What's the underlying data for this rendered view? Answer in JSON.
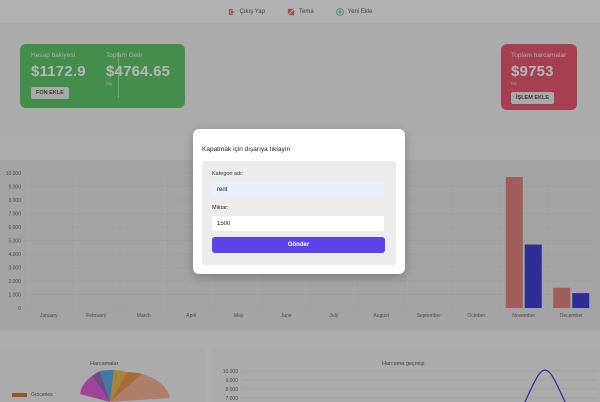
{
  "nav": {
    "logout_label": "Çıkış Yap",
    "theme_label": "Tema",
    "add_label": "Yeni Ekle"
  },
  "balance_card": {
    "balance_label": "Hesap bakiyesi",
    "balance_value": "$1172.9",
    "income_label": "Toplam Gelir",
    "income_value": "$4764.65",
    "income_sub": "/ay",
    "button_label": "FON EKLE"
  },
  "expense_card": {
    "label": "Toplam harcamalar",
    "value": "$9753",
    "sub": "/ay",
    "button_label": "İŞLEM EKLE"
  },
  "modal": {
    "title": "Kapatmak için dışarıya tıklayın",
    "category_label": "Kategori adı:",
    "category_value": "rent",
    "amount_label": "Miktar:",
    "amount_value": "1500",
    "submit_label": "Gönder"
  },
  "bottom": {
    "pie_title": "Harcamalar",
    "pie_legend": "Groceries",
    "history_title": "Harcama geçmişi",
    "history_ticks": [
      "10.000",
      "9.000",
      "8.000",
      "7.000"
    ]
  },
  "chart_data": {
    "type": "bar",
    "categories": [
      "January",
      "February",
      "March",
      "April",
      "May",
      "June",
      "July",
      "August",
      "September",
      "October",
      "November",
      "December"
    ],
    "ylim": [
      0,
      10000
    ],
    "yticks": [
      "0",
      "1.000",
      "2.000",
      "3.000",
      "4.000",
      "5.000",
      "6.000",
      "7.000",
      "8.000",
      "9.000",
      "10.000"
    ],
    "series": [
      {
        "color": "#d9675f",
        "values": [
          0,
          0,
          0,
          0,
          0,
          0,
          0,
          0,
          0,
          0,
          9700,
          1500
        ]
      },
      {
        "color": "#1414c8",
        "values": [
          0,
          0,
          0,
          0,
          0,
          0,
          0,
          0,
          0,
          0,
          4700,
          1100
        ]
      }
    ]
  },
  "colors": {
    "green": "#3cba48",
    "red": "#e33451",
    "submit": "#5b43e8"
  }
}
